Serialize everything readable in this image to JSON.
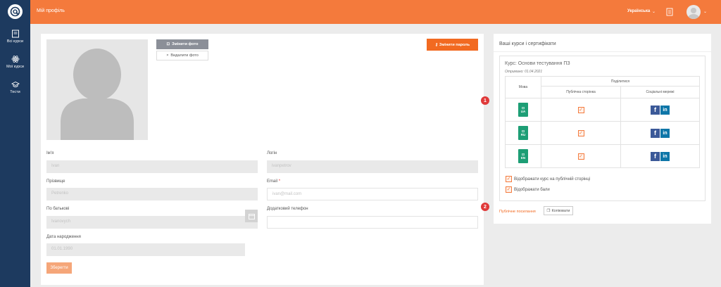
{
  "sidebar": {
    "items": [
      {
        "label": "Всі курси",
        "icon": "book-icon"
      },
      {
        "label": "Мої курси",
        "icon": "atom-icon"
      },
      {
        "label": "Тести",
        "icon": "graduation-cap-icon"
      }
    ]
  },
  "header": {
    "title": "Мій профіль",
    "language": "Українська"
  },
  "profile": {
    "change_photo": "Змінити фото",
    "delete_photo": "Видалити фото",
    "change_password": "Змінити пароль",
    "fields": {
      "name_label": "Ім'я",
      "name_value": "Ivan",
      "login_label": "Логін",
      "login_value": "ivanpetrov",
      "surname_label": "Прізвище",
      "surname_value": "Petrenko",
      "email_label": "Email",
      "email_value": "ivan@mail.com",
      "patronymic_label": "По батькові",
      "patronymic_value": "Ivanovych",
      "phone_label": "Додатковий телефон",
      "phone_value": "",
      "birthdate_label": "Дата народження",
      "birthdate_value": "01.01.1990"
    },
    "save": "Зберегти"
  },
  "courses": {
    "title": "Ваші курси і сертифікати",
    "course_title": "Курс: Основи тестування ПЗ",
    "received": "Отримано: 01.04.2021",
    "table": {
      "col_language": "Мова",
      "col_share": "Поділитися",
      "col_public": "Публічна сторінка",
      "col_social": "Соціальні мережі",
      "rows": [
        {
          "lang": "UA",
          "public": true
        },
        {
          "lang": "RU",
          "public": true
        },
        {
          "lang": "EN",
          "public": true
        }
      ]
    },
    "option_show_public": "Відображати курс на публічній сторінці",
    "option_show_scores": "Відображати бали",
    "public_link": "Публічне посилання",
    "copy": "Копіювати"
  },
  "markers": [
    "1",
    "2"
  ],
  "colors": {
    "accent": "#f47a3c",
    "sidebar": "#1d3a5f",
    "badge": "#1d9e75",
    "marker": "#e03a3a"
  }
}
